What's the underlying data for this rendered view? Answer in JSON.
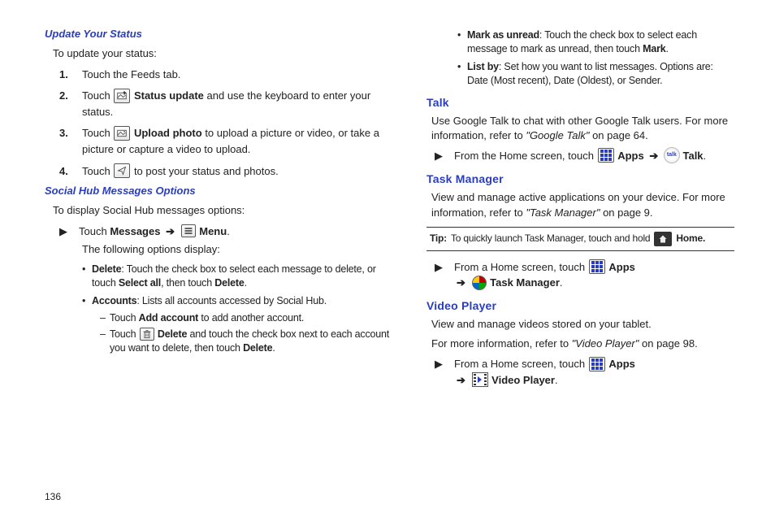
{
  "left": {
    "update_status": {
      "heading": "Update Your Status",
      "intro": "To update your status:",
      "steps": [
        {
          "num": "1.",
          "pre": "Touch the Feeds tab.",
          "bold": "",
          "post": ""
        },
        {
          "num": "2.",
          "pre": "Touch ",
          "bold": "Status update",
          "post": " and use the keyboard to enter your status."
        },
        {
          "num": "3.",
          "pre": "Touch ",
          "bold": "Upload photo",
          "post": " to upload a picture or video, or take a picture or capture a video to upload."
        },
        {
          "num": "4.",
          "pre": "Touch ",
          "bold": "",
          "post": " to post your status and photos."
        }
      ]
    },
    "social_hub": {
      "heading": "Social Hub Messages Options",
      "intro": "To display Social Hub messages options:",
      "touch_pre": "Touch ",
      "messages_label": "Messages",
      "arrow": "➔",
      "menu_label": "Menu",
      "following": "The following options display:",
      "bullets": [
        {
          "bold": "Delete",
          "rest": ": Touch the check box to select each message to delete, or touch ",
          "bold2": "Select all",
          "rest2": ", then touch ",
          "bold3": "Delete",
          "rest3": "."
        },
        {
          "bold": "Accounts",
          "rest": ": Lists all accounts accessed by Social Hub."
        }
      ],
      "dashes": [
        {
          "pre": "Touch ",
          "bold": "Add account",
          "post": " to add another account."
        },
        {
          "pre": "Touch ",
          "bold": "Delete",
          "post": " and touch the check box next to each account you want to delete, then touch ",
          "bold2": "Delete",
          "post2": "."
        }
      ]
    }
  },
  "right": {
    "top_bullets": [
      {
        "bold": "Mark as unread",
        "rest": ": Touch the check box to select each message to mark as unread, then touch ",
        "bold2": "Mark",
        "rest2": "."
      },
      {
        "bold": "List by",
        "rest": ": Set how you want to list messages. Options are: Date (Most recent), Date (Oldest), or Sender."
      }
    ],
    "talk": {
      "heading": "Talk",
      "body_pre": "Use Google Talk to chat with other Google Talk users. For more information, refer to ",
      "body_ref": "\"Google Talk\"",
      "body_post": " on page 64.",
      "action_pre": "From the Home screen, touch ",
      "apps_label": "Apps",
      "arrow": "➔",
      "talk_label": "Talk",
      "talk_icon_text": "talk"
    },
    "task_manager": {
      "heading": "Task Manager",
      "body_pre": "View and manage active applications on your device. For more information, refer to ",
      "body_ref": "\"Task Manager\"",
      "body_post": " on page 9.",
      "tip_label": "Tip:",
      "tip_text": " To quickly launch Task Manager, touch and hold ",
      "home_label": "Home.",
      "action_pre": "From a Home screen, touch ",
      "apps_label": "Apps",
      "arrow": "➔",
      "tm_label": "Task Manager"
    },
    "video_player": {
      "heading": "Video Player",
      "body1": "View and manage videos stored on your tablet.",
      "body2_pre": "For more information, refer to ",
      "body2_ref": "\"Video Player\"",
      "body2_post": " on page 98.",
      "action_pre": "From a Home screen, touch ",
      "apps_label": "Apps",
      "arrow": "➔",
      "vp_label": "Video Player"
    }
  },
  "page_number": "136"
}
